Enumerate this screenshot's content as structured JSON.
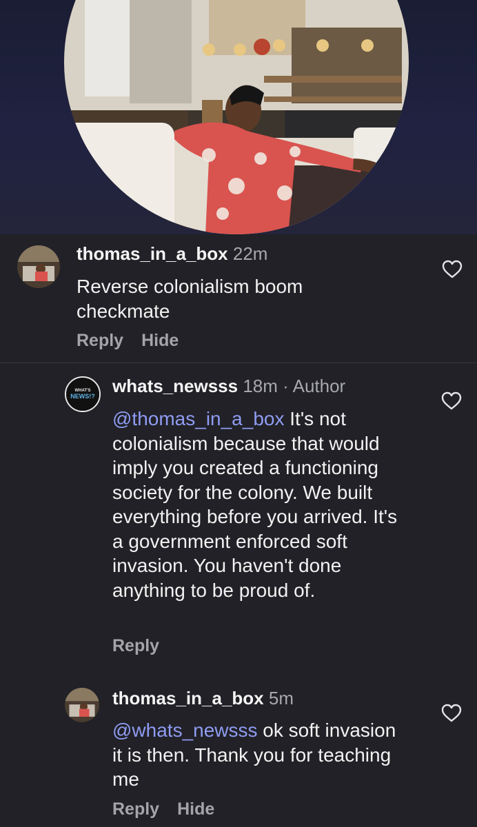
{
  "hero": {
    "image": "post photo: man in floral shirt seated on a couch in a cafe"
  },
  "comments": [
    {
      "username": "thomas_in_a_box",
      "time": "22m",
      "author_tag": "",
      "mention": "",
      "text": "Reverse colonialism boom checkmate",
      "actions": [
        "Reply",
        "Hide"
      ],
      "avatar": "profile photo"
    },
    {
      "username": "whats_newsss",
      "time": "18m",
      "separator": "·",
      "author_tag": "Author",
      "mention": "@thomas_in_a_box",
      "text": "It's not colonialism because that would imply you created a functioning society for the colony. We built everything before you arrived. It's a government enforced soft invasion. You haven't done anything to be proud of.",
      "actions": [
        "Reply"
      ],
      "avatar_text": "WHAT'S NEWS!?"
    },
    {
      "username": "thomas_in_a_box",
      "time": "5m",
      "author_tag": "",
      "mention": "@whats_newsss",
      "text": "ok soft invasion it is then. Thank you for teaching me",
      "actions": [
        "Reply",
        "Hide"
      ],
      "avatar": "profile photo"
    }
  ],
  "icons": {
    "like": "heart-outline-icon"
  },
  "colors": {
    "background": "#212127",
    "mention": "#8f9cf2",
    "muted": "#a7a7ae"
  }
}
